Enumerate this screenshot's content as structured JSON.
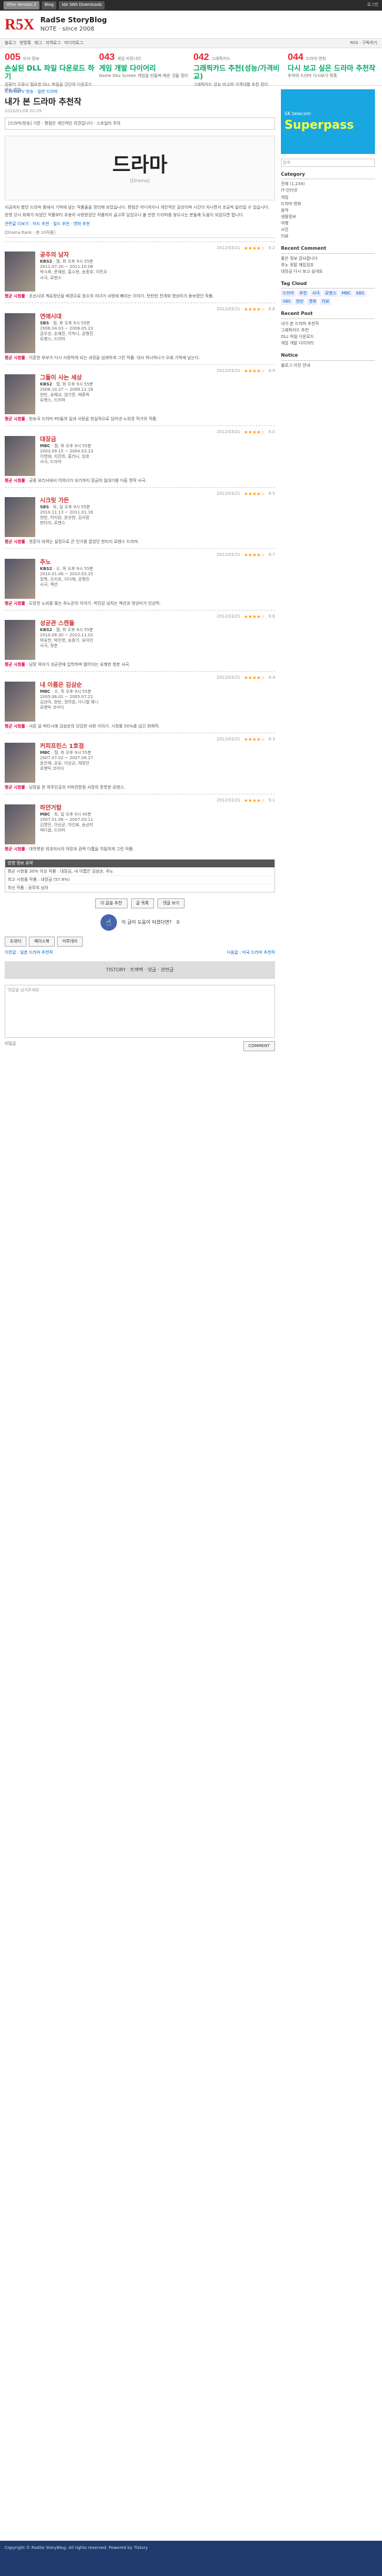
{
  "topbar": {
    "tabs": [
      "Xfire Version 2",
      "Blog",
      "Idx SNS Downloads"
    ],
    "right": "로그인"
  },
  "header": {
    "logo_main": "R5X",
    "logo_accent": "",
    "title": "RadSe StoryBlog",
    "subtitle": "NOTE · since 2008"
  },
  "nav": {
    "items": [
      "블로그",
      "방명록",
      "태그",
      "지역로그",
      "미디어로그"
    ],
    "right": "RSS · 구독하기"
  },
  "featured": [
    {
      "num": "005",
      "cat": "지식·정보",
      "title": "손실된 DLL 파일 다운로드 하기",
      "desc": "컴퓨터 오류시 필요한 DLL 파일을 간단히 다운로드 받는 방법"
    },
    {
      "num": "043",
      "cat": "게임·커뮤니티",
      "title": "게임 개발 다이어리",
      "desc": "Game Dev Screen 게임을 만들며 배운 것들 정리"
    },
    {
      "num": "042",
      "cat": "그래픽카드",
      "title": "그래픽카드 추천(성능/가격비교)",
      "desc": "그래픽카드 성능 비교와 가격대별 추천 정리"
    },
    {
      "num": "044",
      "cate": "",
      "cat": "드라마·영화",
      "title": "다시 보고 싶은 드라마 추천작",
      "desc": "추억의 드라마 다시보기 목록"
    }
  ],
  "main": {
    "crumb": "드라마&TV 방송 · 일반 드라마",
    "page_title": "내가 본 드라마 추천작",
    "page_meta": "2010/01/08 02:09",
    "notice": "[드라마/방송] 기준 · 평점은 개인적인 의견입니다 · 스포일러 주의",
    "banner_big": "드라마",
    "banner_sm": "[Drama]",
    "intro": [
      "지금까지 봤던 드라마 중에서 기억에 남는 작품들을 정리해 보았습니다. 평점은 어디까지나 개인적인 감상이며 시간이 지나면서 조금씩 달라질 수 있습니다.",
      "방영 당시 화제가 되었던 작품부터 조용히 사랑받았던 작품까지 골고루 담았으니 볼 만한 드라마를 찾으시는 분들께 도움이 되었으면 합니다."
    ],
    "related": "관련글 더보기 : 미드 추천 · 일드 추천 · 영화 추천",
    "list_header": "[Drama Rank : 총 10작품]",
    "dramas": [
      {
        "date": "2012/03/21",
        "score": "9.2",
        "title": "공주의 남자",
        "ch": "KBS2",
        "time": "월, 화 오후 9시 55분",
        "period": "2011.07.20 ~ 2011.10.06",
        "cast": "박시후, 문채원, 홍수현, 송종호, 이민우",
        "genre": "사극, 로맨스",
        "review_label": "평균 시청률",
        "review": "조선시대 계유정난을 배경으로 원수의 자녀가 사랑에 빠지는 이야기. 탄탄한 전개와 영상미가 돋보였던 작품."
      },
      {
        "date": "2012/03/21",
        "score": "8.8",
        "title": "연애시대",
        "ch": "SBS",
        "time": "월, 화 오후 9시 55분",
        "period": "2006.04.03 ~ 2006.05.23",
        "cast": "감우성, 손예진, 이하나, 공형진",
        "genre": "로맨스, 드라마",
        "review_label": "평균 시청률",
        "review": "이혼한 부부가 다시 사랑하게 되는 과정을 섬세하게 그린 작품. 대사 하나하나가 오래 기억에 남는다."
      },
      {
        "date": "2012/03/21",
        "score": "8.9",
        "title": "그들이 사는 세상",
        "ch": "KBS2",
        "time": "월, 화 오후 9시 55분",
        "period": "2008.10.27 ~ 2008.12.16",
        "cast": "현빈, 송혜교, 엄기준, 배종옥",
        "genre": "로맨스, 드라마",
        "review_label": "평균 시청률",
        "review": "방송국 드라마 PD들의 일과 사랑을 현실적으로 담아낸 노희경 작가의 작품."
      },
      {
        "date": "2012/03/21",
        "score": "9.0",
        "title": "대장금",
        "ch": "MBC",
        "time": "월, 화 오후 9시 55분",
        "period": "2003.09.15 ~ 2004.03.23",
        "cast": "이영애, 지진희, 홍리나, 임호",
        "genre": "사극, 드라마",
        "review_label": "평균 시청률",
        "review": "궁중 요리사에서 어의녀가 되기까지 장금의 일대기를 다룬 명작 사극."
      },
      {
        "date": "2012/03/21",
        "score": "8.5",
        "title": "시크릿 가든",
        "ch": "SBS",
        "time": "토, 일 오후 9시 55분",
        "period": "2010.11.13 ~ 2011.01.16",
        "cast": "현빈, 하지원, 윤상현, 김사랑",
        "genre": "판타지, 로맨스",
        "review_label": "평균 시청률",
        "review": "영혼이 바뀌는 설정으로 큰 인기를 끌었던 판타지 로맨스 드라마."
      },
      {
        "date": "2012/03/21",
        "score": "8.7",
        "title": "추노",
        "ch": "KBS2",
        "time": "수, 목 오후 9시 55분",
        "period": "2010.01.06 ~ 2010.03.25",
        "cast": "장혁, 오지호, 이다해, 공형진",
        "genre": "사극, 액션",
        "review_label": "평균 시청률",
        "review": "도망친 노비를 쫓는 추노꾼의 이야기. 박진감 넘치는 액션과 영상미가 인상적."
      },
      {
        "date": "2012/03/21",
        "score": "8.6",
        "title": "성균관 스캔들",
        "ch": "KBS2",
        "time": "월, 화 오후 9시 55분",
        "period": "2010.08.30 ~ 2010.11.02",
        "cast": "박유천, 박민영, 송중기, 유아인",
        "genre": "사극, 청춘",
        "review_label": "평균 시청률",
        "review": "남장 여자가 성균관에 입학하며 벌어지는 유쾌한 청춘 사극."
      },
      {
        "date": "2012/03/21",
        "score": "8.4",
        "title": "내 이름은 김삼순",
        "ch": "MBC",
        "time": "수, 목 오후 9시 55분",
        "period": "2005.06.01 ~ 2005.07.21",
        "cast": "김선아, 현빈, 정려원, 다니엘 헤니",
        "genre": "로맨틱 코미디",
        "review_label": "평균 시청률",
        "review": "서른 살 파티시에 김삼순의 당당한 사랑 이야기. 시청률 50%를 넘긴 화제작."
      },
      {
        "date": "2012/03/21",
        "score": "8.3",
        "title": "커피프린스 1호점",
        "ch": "MBC",
        "time": "월, 화 오후 9시 55분",
        "period": "2007.07.02 ~ 2007.08.27",
        "cast": "윤은혜, 공유, 이선균, 채정안",
        "genre": "로맨틱 코미디",
        "review_label": "평균 시청률",
        "review": "남장을 한 여주인공과 커피전문점 사장의 풋풋한 로맨스."
      },
      {
        "date": "2012/03/21",
        "score": "9.1",
        "title": "하얀거탑",
        "ch": "MBC",
        "time": "토, 일 오후 9시 40분",
        "period": "2007.01.06 ~ 2007.03.11",
        "cast": "김명민, 이선균, 차인표, 송선미",
        "genre": "메디컬, 드라마",
        "review_label": "평균 시청률",
        "review": "대학병원 외과의사의 야망과 권력 다툼을 치밀하게 그린 작품."
      }
    ],
    "table_title": "방영 정보 요약",
    "table_rows": [
      "평균 시청률 30% 이상 작품 : 대장금, 내 이름은 김삼순, 추노",
      "최고 시청률 작품 : 대장금 (57.8%)",
      "최신 작품 : 공주의 남자"
    ],
    "controls": [
      "이 글을 추천",
      "글 목록",
      "댓글 보기"
    ],
    "like_label": "이 글이 도움이 되셨다면?",
    "like_count": "0",
    "share": [
      "트위터",
      "페이스북",
      "미투데이"
    ],
    "prev": "이전글 : 일본 드라마 추천작",
    "next": "다음글 : 미국 드라마 추천작",
    "bottom_banner": "TISTORY · 트랙백 · 댓글 · 관련글",
    "comment_placeholder": "댓글을 남겨주세요",
    "comment_secret": "비밀글",
    "comment_submit": "COMMENT"
  },
  "sidebar": {
    "ad_line1": "SK telecom",
    "ad_line2": "Superpass",
    "search_placeholder": "검색",
    "category_title": "Category",
    "categories": [
      "전체 (1,234)",
      "IT·인터넷",
      "게임",
      "드라마·영화",
      "음악",
      "생활정보",
      "여행",
      "사진",
      "리뷰"
    ],
    "recent_title": "Recent Comment",
    "recent": [
      "좋은 정보 감사합니다",
      "추노 정말 재밌었죠",
      "대장금 다시 보고 싶네요"
    ],
    "tag_title": "Tag Cloud",
    "tags": [
      "드라마",
      "추천",
      "사극",
      "로맨스",
      "MBC",
      "KBS",
      "SBS",
      "현빈",
      "영화",
      "리뷰"
    ],
    "recent_post_title": "Recent Post",
    "recent_posts": [
      "내가 본 드라마 추천작",
      "그래픽카드 추천",
      "DLL 파일 다운로드",
      "게임 개발 다이어리"
    ],
    "notice_title": "Notice",
    "notice": "블로그 이전 안내"
  },
  "footer": {
    "text": "Copyright © RadSe StoryBlog. All rights reserved. Powered by Tistory"
  }
}
